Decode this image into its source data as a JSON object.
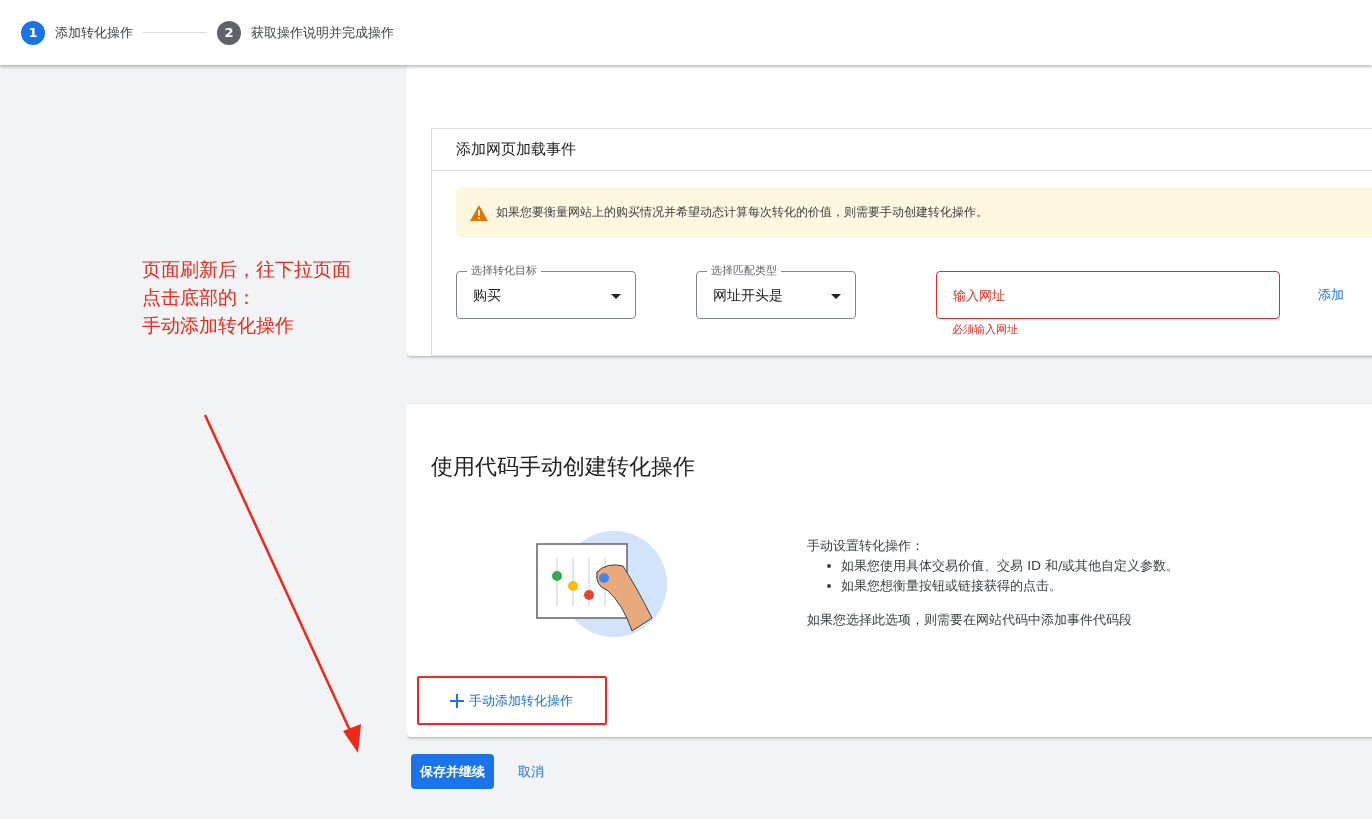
{
  "steps": [
    {
      "number": "1",
      "label": "添加转化操作",
      "selected": true
    },
    {
      "number": "2",
      "label": "获取操作说明并完成操作",
      "selected": false
    }
  ],
  "annotation": {
    "lines": [
      "页面刷新后，往下拉页面",
      "点击底部的：",
      "手动添加转化操作"
    ]
  },
  "page_load_card": {
    "title": "添加网页加载事件",
    "alert": "如果您要衡量网站上的购买情况并希望动态计算每次转化的价值，则需要手动创建转化操作。",
    "goal_select": {
      "label": "选择转化目标",
      "value": "购买"
    },
    "match_select": {
      "label": "选择匹配类型",
      "value": "网址开头是"
    },
    "url_field": {
      "placeholder": "输入网址",
      "error": "必须输入网址",
      "invalid": true
    },
    "add_link": "添加"
  },
  "manual_card": {
    "title": "使用代码手动创建转化操作",
    "intro": "手动设置转化操作：",
    "bullets": [
      "如果您使用具体交易价值、交易 ID 和/或其他自定义参数。",
      "如果您想衡量按钮或链接获得的点击。"
    ],
    "note": "如果您选择此选项，则需要在网站代码中添加事件代码段",
    "add_button": "手动添加转化操作",
    "highlighted": true
  },
  "actions": {
    "save": "保存并继续",
    "cancel": "取消"
  }
}
